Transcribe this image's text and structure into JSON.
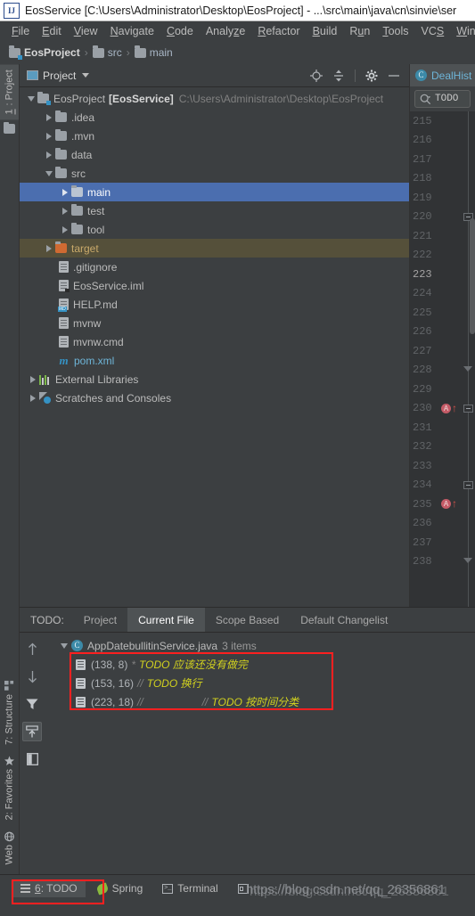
{
  "window": {
    "title": "EosService [C:\\Users\\Administrator\\Desktop\\EosProject] - ...\\src\\main\\java\\cn\\sinvie\\ser",
    "logo": "IJ"
  },
  "menubar": {
    "items": [
      {
        "label": "File",
        "mnemonic": "F"
      },
      {
        "label": "Edit",
        "mnemonic": "E"
      },
      {
        "label": "View",
        "mnemonic": "V"
      },
      {
        "label": "Navigate",
        "mnemonic": "N"
      },
      {
        "label": "Code",
        "mnemonic": "C"
      },
      {
        "label": "Analyze",
        "mnemonic": "z"
      },
      {
        "label": "Refactor",
        "mnemonic": "R"
      },
      {
        "label": "Build",
        "mnemonic": "B"
      },
      {
        "label": "Run",
        "mnemonic": "u"
      },
      {
        "label": "Tools",
        "mnemonic": "T"
      },
      {
        "label": "VCS",
        "mnemonic": "S"
      },
      {
        "label": "Window",
        "mnemonic": "W"
      }
    ]
  },
  "breadcrumb": {
    "items": [
      "EosProject",
      "src",
      "main"
    ],
    "separator": "›"
  },
  "left_strip": {
    "top": [
      {
        "label": "1: Project",
        "number": "1"
      }
    ],
    "bottom": [
      {
        "label": "7: Structure",
        "number": "7",
        "icon": "structure-icon"
      },
      {
        "label": "2: Favorites",
        "number": "2",
        "icon": "star-icon"
      },
      {
        "label": "Web",
        "icon": "globe-icon"
      }
    ]
  },
  "project_panel": {
    "title": "Project",
    "actions": [
      "locate-icon",
      "collapse-all-icon",
      "settings-gear-icon",
      "minimize-icon"
    ],
    "tree": [
      {
        "indent": 0,
        "arrow": "down",
        "icon": "project-folder-icon",
        "label": "EosProject",
        "bold": "[EosService]",
        "dim": "C:\\Users\\Administrator\\Desktop\\EosProject",
        "state": "normal"
      },
      {
        "indent": 1,
        "arrow": "right",
        "icon": "folder-icon",
        "label": ".idea",
        "state": "normal"
      },
      {
        "indent": 1,
        "arrow": "right",
        "icon": "folder-icon",
        "label": ".mvn",
        "state": "normal"
      },
      {
        "indent": 1,
        "arrow": "right",
        "icon": "folder-icon",
        "label": "data",
        "state": "normal"
      },
      {
        "indent": 1,
        "arrow": "down",
        "icon": "folder-icon",
        "label": "src",
        "state": "normal"
      },
      {
        "indent": 2,
        "arrow": "right",
        "icon": "folder-icon",
        "label": "main",
        "state": "selected"
      },
      {
        "indent": 2,
        "arrow": "right",
        "icon": "folder-icon",
        "label": "test",
        "state": "normal"
      },
      {
        "indent": 2,
        "arrow": "right",
        "icon": "folder-icon",
        "label": "tool",
        "state": "normal"
      },
      {
        "indent": 1,
        "arrow": "right",
        "icon": "folder-excluded-icon",
        "label": "target",
        "state": "context"
      },
      {
        "indent": 2,
        "arrow": "none",
        "icon": "file-icon",
        "label": ".gitignore",
        "state": "normal"
      },
      {
        "indent": 2,
        "arrow": "none",
        "icon": "iml-file-icon",
        "label": "EosService.iml",
        "state": "normal"
      },
      {
        "indent": 2,
        "arrow": "none",
        "icon": "markdown-file-icon",
        "label": "HELP.md",
        "state": "normal"
      },
      {
        "indent": 2,
        "arrow": "none",
        "icon": "file-icon",
        "label": "mvnw",
        "state": "normal"
      },
      {
        "indent": 2,
        "arrow": "none",
        "icon": "file-icon",
        "label": "mvnw.cmd",
        "state": "normal"
      },
      {
        "indent": 2,
        "arrow": "none",
        "icon": "maven-file-icon",
        "label": "pom.xml",
        "state": "normal"
      },
      {
        "indent": 0,
        "arrow": "right",
        "icon": "libraries-icon",
        "label": "External Libraries",
        "state": "normal"
      },
      {
        "indent": 0,
        "arrow": "right",
        "icon": "scratches-icon",
        "label": "Scratches and Consoles",
        "state": "normal"
      }
    ]
  },
  "editor": {
    "tab": {
      "label": "DealHist",
      "icon": "java-class-icon"
    },
    "find": {
      "value": "TODO",
      "icon": "search-icon"
    },
    "lines": [
      {
        "num": "215"
      },
      {
        "num": "216"
      },
      {
        "num": "217"
      },
      {
        "num": "218"
      },
      {
        "num": "219"
      },
      {
        "num": "220"
      },
      {
        "num": "221"
      },
      {
        "num": "222"
      },
      {
        "num": "223",
        "current": true
      },
      {
        "num": "224"
      },
      {
        "num": "225"
      },
      {
        "num": "226"
      },
      {
        "num": "227"
      },
      {
        "num": "228"
      },
      {
        "num": "229"
      },
      {
        "num": "230",
        "marker": "override"
      },
      {
        "num": "231"
      },
      {
        "num": "232"
      },
      {
        "num": "233"
      },
      {
        "num": "234"
      },
      {
        "num": "235",
        "marker": "override"
      },
      {
        "num": "236"
      },
      {
        "num": "237"
      },
      {
        "num": "238"
      }
    ],
    "override_glyph": "A"
  },
  "todo_panel": {
    "label": "TODO:",
    "tabs": [
      {
        "label": "Project",
        "active": false
      },
      {
        "label": "Current File",
        "active": true
      },
      {
        "label": "Scope Based",
        "active": false
      },
      {
        "label": "Default Changelist",
        "active": false
      }
    ],
    "side_actions": [
      {
        "name": "previous-occurrence-icon",
        "on": false
      },
      {
        "name": "next-occurrence-icon",
        "on": false
      },
      {
        "name": "filter-icon",
        "on": false
      },
      {
        "name": "autoscroll-to-source-icon",
        "on": true
      },
      {
        "name": "preview-icon",
        "on": false
      }
    ],
    "file_node": {
      "name": "AppDatebullitinService.java",
      "count": "3 items",
      "icon": "java-class-icon"
    },
    "items": [
      {
        "coord": "(138, 8)",
        "comment": "*",
        "gap": false,
        "text": "TODO 应该还没有做完"
      },
      {
        "coord": "(153, 16)",
        "comment": "//",
        "gap": false,
        "text": "TODO 换行"
      },
      {
        "coord": "(223, 18)",
        "comment": "//",
        "gap": true,
        "gap_comment": "//",
        "text": "TODO 按时间分类"
      }
    ]
  },
  "statusbar": {
    "items": [
      {
        "label": "6: TODO",
        "number": "6",
        "icon": "todo-list-icon",
        "active": true
      },
      {
        "label": "Spring",
        "icon": "spring-leaf-icon",
        "active": false
      },
      {
        "label": "Terminal",
        "icon": "terminal-icon",
        "active": false
      },
      {
        "label": "",
        "icon": "database-icon",
        "active": false
      }
    ],
    "watermark": "https://blog.csdn.net/qq_26356861"
  },
  "colors": {
    "accent_selection": "#4b6eaf",
    "panel_bg": "#3c3f41",
    "editor_bg": "#313335",
    "todo_yellow": "#d2d21f",
    "highlight_red": "#ff2020",
    "link_blue": "#6eb5d8",
    "folder_excluded": "#cf6a32"
  }
}
